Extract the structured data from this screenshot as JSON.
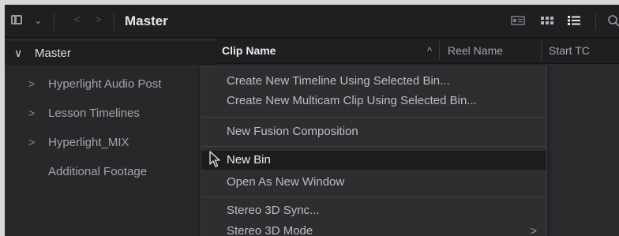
{
  "toolbar": {
    "title": "Master",
    "icons": [
      "sidebar-toggle-icon",
      "chevron-down-icon",
      "back-arrow-icon",
      "forward-arrow-icon",
      "metadata-view-icon",
      "thumbnail-view-icon",
      "list-view-icon",
      "search-icon"
    ]
  },
  "sidebar": {
    "root": {
      "label": "Master",
      "caret": "∨"
    },
    "items": [
      {
        "label": "Hyperlight Audio Post",
        "caret": ">"
      },
      {
        "label": "Lesson Timelines",
        "caret": ">"
      },
      {
        "label": "Hyperlight_MIX",
        "caret": ">"
      },
      {
        "label": "Additional Footage",
        "caret": ""
      }
    ]
  },
  "list_header": {
    "columns": [
      {
        "label": "Clip Name",
        "sort": "^"
      },
      {
        "label": "Reel Name"
      },
      {
        "label": "Start TC"
      }
    ]
  },
  "context_menu": {
    "items": [
      {
        "label": "Create New Timeline Using Selected Bin..."
      },
      {
        "label": "Create New Multicam Clip Using Selected Bin..."
      },
      {
        "label": "New Fusion Composition"
      },
      {
        "label": "New Bin",
        "highlighted": true
      },
      {
        "label": "Open As New Window"
      },
      {
        "label": "Stereo 3D Sync..."
      },
      {
        "label": "Stereo 3D Mode",
        "submenu": ">"
      }
    ]
  },
  "colors": {
    "background": "#26262a",
    "toolbar": "#1f1f22",
    "menu": "#2e2e31",
    "highlight": "#1d1d20"
  }
}
